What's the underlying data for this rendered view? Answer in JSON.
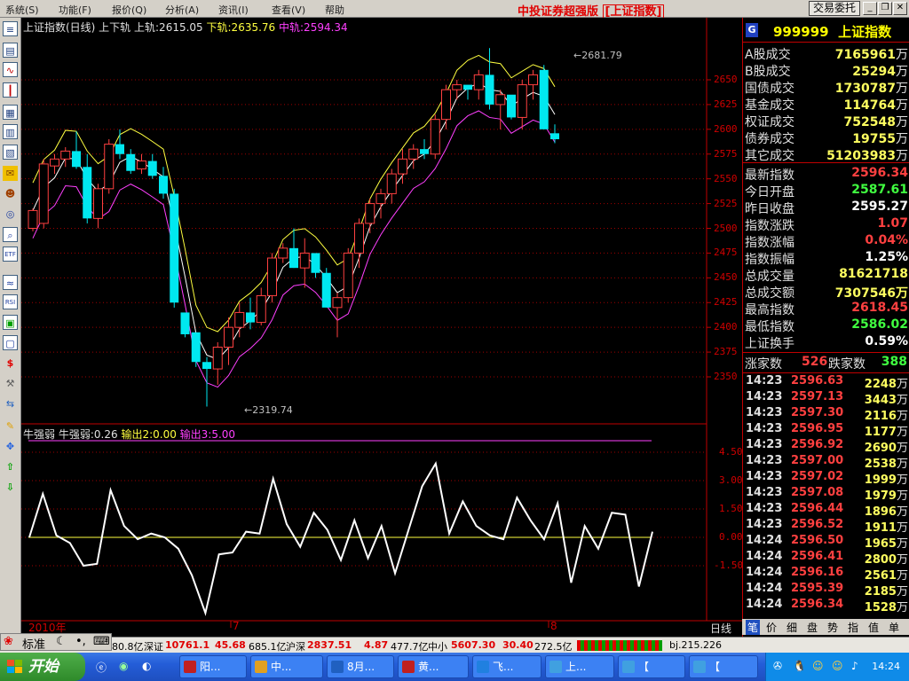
{
  "menu": [
    "系统(S)",
    "功能(F)",
    "报价(Q)",
    "分析(A)",
    "资讯(I)",
    "查看(V)",
    "帮助"
  ],
  "app": {
    "title": "中投证券超强版",
    "index_name": "[上证指数]",
    "trade_btn": "交易委托"
  },
  "main_chart": {
    "indicator_name": "上证指数(日线) 上下轨",
    "upper_label": "上轨:2615.05",
    "lower_label": "下轨:2635.76",
    "mid_label": "中轨:2594.34",
    "y_ticks": [
      "2650",
      "2625",
      "2600",
      "2575",
      "2550",
      "2525",
      "2500",
      "2475",
      "2450",
      "2425",
      "2400",
      "2375",
      "2350"
    ],
    "high_annotation": "2681.79",
    "low_annotation": "2319.74",
    "colors": {
      "up": "#ff4040",
      "down": "#00e8f0",
      "upper": "#ffff40",
      "mid": "#ffffff",
      "lower": "#ff40ff"
    }
  },
  "osc_chart": {
    "name": "牛强弱",
    "value_label": "牛强弱:0.26",
    "out2_label": "输出2:0.00",
    "out3_label": "输出3:5.00",
    "y_ticks": [
      "4.50",
      "3.00",
      "1.50",
      "0.00",
      "-1.50"
    ],
    "values": [
      0.0,
      2.3,
      0.1,
      -0.3,
      -1.5,
      -1.4,
      2.5,
      0.6,
      -0.1,
      0.2,
      0.0,
      -0.6,
      -2.0,
      -4.0,
      -0.9,
      -0.8,
      0.3,
      0.2,
      3.1,
      0.7,
      -0.5,
      1.3,
      0.4,
      -1.2,
      0.9,
      -1.1,
      0.6,
      -1.9,
      0.4,
      2.7,
      3.9,
      0.2,
      1.9,
      0.6,
      0.1,
      -0.1,
      2.1,
      0.9,
      -0.1,
      1.8,
      -2.4,
      0.6,
      -0.6,
      1.3,
      1.2,
      -2.6,
      0.3
    ]
  },
  "x_labels": {
    "year": "2010年",
    "m7": "7",
    "m8": "8"
  },
  "quote": {
    "code": "999999",
    "name": "上证指数",
    "volumes": [
      {
        "label": "A股成交",
        "value": "7165961",
        "unit": "万"
      },
      {
        "label": "B股成交",
        "value": "25294",
        "unit": "万"
      },
      {
        "label": "国债成交",
        "value": "1730787",
        "unit": "万"
      },
      {
        "label": "基金成交",
        "value": "114764",
        "unit": "万"
      },
      {
        "label": "权证成交",
        "value": "752548",
        "unit": "万"
      },
      {
        "label": "债券成交",
        "value": "19755",
        "unit": "万"
      },
      {
        "label": "其它成交",
        "value": "51203983",
        "unit": "万"
      }
    ],
    "stats": [
      {
        "label": "最新指数",
        "value": "2596.34",
        "color": "#ff4040"
      },
      {
        "label": "今日开盘",
        "value": "2587.61",
        "color": "#40ff40"
      },
      {
        "label": "昨日收盘",
        "value": "2595.27",
        "color": "#ffffff"
      },
      {
        "label": "指数涨跌",
        "value": "1.07",
        "color": "#ff4040"
      },
      {
        "label": "指数涨幅",
        "value": "0.04%",
        "color": "#ff4040"
      },
      {
        "label": "指数振幅",
        "value": "1.25%",
        "color": "#ffffff"
      },
      {
        "label": "总成交量",
        "value": "81621718",
        "color": "#ffff60"
      },
      {
        "label": "总成交额",
        "value": "7307546万",
        "color": "#ffff60"
      },
      {
        "label": "最高指数",
        "value": "2618.45",
        "color": "#ff4040"
      },
      {
        "label": "最低指数",
        "value": "2586.02",
        "color": "#40ff40"
      },
      {
        "label": "上证换手",
        "value": "0.59%",
        "color": "#ffffff"
      }
    ],
    "up_label": "涨家数",
    "up_count": "526",
    "down_label": "跌家数",
    "down_count": "388",
    "ticks": [
      {
        "t": "14:23",
        "p": "2596.63",
        "v": "2248"
      },
      {
        "t": "14:23",
        "p": "2597.13",
        "v": "3443"
      },
      {
        "t": "14:23",
        "p": "2597.30",
        "v": "2116"
      },
      {
        "t": "14:23",
        "p": "2596.95",
        "v": "1177"
      },
      {
        "t": "14:23",
        "p": "2596.92",
        "v": "2690"
      },
      {
        "t": "14:23",
        "p": "2597.00",
        "v": "2538"
      },
      {
        "t": "14:23",
        "p": "2597.02",
        "v": "1999"
      },
      {
        "t": "14:23",
        "p": "2597.08",
        "v": "1979"
      },
      {
        "t": "14:23",
        "p": "2596.44",
        "v": "1896"
      },
      {
        "t": "14:23",
        "p": "2596.52",
        "v": "1911"
      },
      {
        "t": "14:24",
        "p": "2596.50",
        "v": "1965"
      },
      {
        "t": "14:24",
        "p": "2596.41",
        "v": "2800"
      },
      {
        "t": "14:24",
        "p": "2596.16",
        "v": "2561"
      },
      {
        "t": "14:24",
        "p": "2595.39",
        "v": "2185"
      },
      {
        "t": "14:24",
        "p": "2596.34",
        "v": "1528"
      }
    ],
    "tick_unit": "万"
  },
  "period_label": "日线",
  "bottom_tabs": [
    "笔",
    "价",
    "细",
    "盘",
    "势",
    "指",
    "值",
    "单"
  ],
  "status": {
    "sh_amt": "80.8亿",
    "sz_label": "深证",
    "sz_val": "10761.1",
    "sz_chg": "45.68",
    "sz_amt": "685.1亿",
    "hs_label": "沪深",
    "hs_val": "2837.51",
    "hs_chg": "4.87",
    "hs_amt": "477.7亿",
    "zx_label": "中小",
    "zx_val": "5607.30",
    "zx_chg": "30.40",
    "zx_amt": "272.5亿",
    "server": "bj.215.226"
  },
  "lang_bar": {
    "mode": "标准"
  },
  "taskbar": {
    "start": "开始",
    "tasks": [
      "阳...",
      "中...",
      "8月...",
      "黄...",
      "飞...",
      "上...",
      "【",
      "【",
      "【"
    ],
    "clock": "14:24"
  }
}
